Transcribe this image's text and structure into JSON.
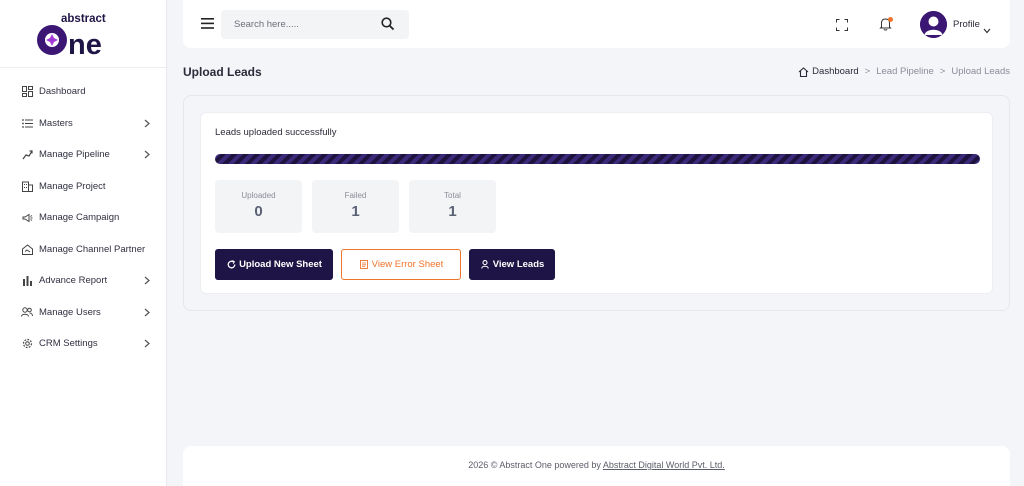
{
  "app": {
    "logo_top": "abstract",
    "logo_main": "one"
  },
  "sidebar": {
    "items": [
      {
        "label": "Dashboard",
        "icon": "dashboard-grid-icon",
        "has_children": false
      },
      {
        "label": "Masters",
        "icon": "list-icon",
        "has_children": true
      },
      {
        "label": "Manage Pipeline",
        "icon": "pipeline-icon",
        "has_children": true
      },
      {
        "label": "Manage Project",
        "icon": "building-icon",
        "has_children": false
      },
      {
        "label": "Manage Campaign",
        "icon": "megaphone-icon",
        "has_children": false
      },
      {
        "label": "Manage Channel Partner",
        "icon": "handshake-icon",
        "has_children": false
      },
      {
        "label": "Advance Report",
        "icon": "bar-chart-icon",
        "has_children": true
      },
      {
        "label": "Manage Users",
        "icon": "users-icon",
        "has_children": true
      },
      {
        "label": "CRM Settings",
        "icon": "gear-icon",
        "has_children": true
      }
    ]
  },
  "topbar": {
    "search_placeholder": "Search here.....",
    "profile_label": "Profile"
  },
  "page": {
    "title": "Upload Leads",
    "breadcrumb": [
      "Dashboard",
      "Lead Pipeline",
      "Upload Leads"
    ],
    "separator": ">"
  },
  "upload": {
    "status": "Leads uploaded successfully",
    "progress_percent": 100,
    "stats": [
      {
        "label": "Uploaded",
        "value": "0"
      },
      {
        "label": "Failed",
        "value": "1"
      },
      {
        "label": "Total",
        "value": "1"
      }
    ],
    "buttons": {
      "upload_new": "Upload New Sheet",
      "view_error": "View Error Sheet",
      "view_leads": "View Leads"
    }
  },
  "footer": {
    "text": "2026 © Abstract One powered by",
    "link": "Abstract Digital World Pvt. Ltd."
  },
  "colors": {
    "brand_dark": "#1f1446",
    "accent_orange": "#f0742a",
    "logo_purple": "#3b1673",
    "logo_magenta": "#a23bd6"
  }
}
